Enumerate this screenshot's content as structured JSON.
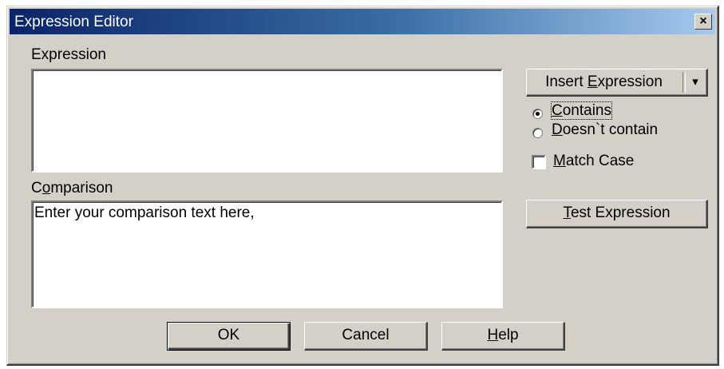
{
  "window": {
    "title": "Expression Editor",
    "close_glyph": "×"
  },
  "expression": {
    "label": "Expression",
    "value": ""
  },
  "comparison": {
    "label_pre": "C",
    "label_mnemonic": "o",
    "label_post": "mparison",
    "value": "Enter your comparison text here,"
  },
  "insert_expression": {
    "label_pre": "Insert ",
    "label_mnemonic": "E",
    "label_post": "xpression",
    "arrow": "▾"
  },
  "match_mode": {
    "contains": {
      "label_mnemonic": "C",
      "label_post": "ontains",
      "selected": true
    },
    "doesnt_contain": {
      "label_mnemonic": "D",
      "label_post": "oesn`t contain",
      "selected": false
    }
  },
  "match_case": {
    "label_mnemonic": "M",
    "label_post": "atch Case",
    "checked": false
  },
  "test_expression": {
    "label_mnemonic": "T",
    "label_post": "est Expression"
  },
  "buttons": {
    "ok": "OK",
    "cancel": "Cancel",
    "help_mnemonic": "H",
    "help_post": "elp"
  }
}
